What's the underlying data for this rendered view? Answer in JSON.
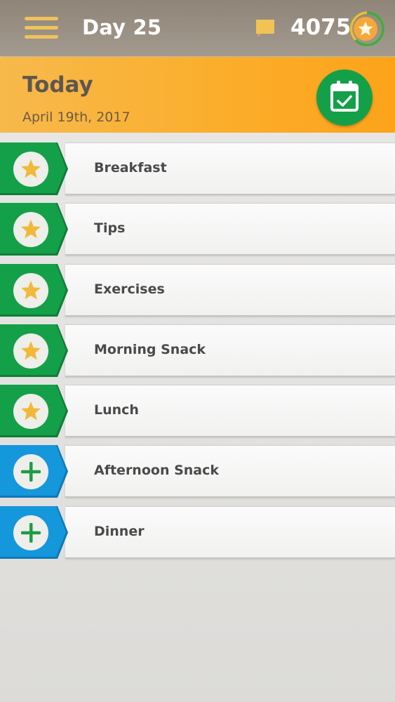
{
  "header": {
    "day_label": "Day 25",
    "points": "4075",
    "icons": {
      "menu": "hamburger-menu-icon",
      "chat": "chat-bubble-icon",
      "badge": "star-badge-icon"
    }
  },
  "today": {
    "title": "Today",
    "date": "April 19th, 2017",
    "calendar_icon": "calendar-check-icon"
  },
  "meals": [
    {
      "label": "Breakfast",
      "status": "completed",
      "icon": "star-icon"
    },
    {
      "label": "Tips",
      "status": "completed",
      "icon": "star-icon"
    },
    {
      "label": "Exercises",
      "status": "completed",
      "icon": "star-icon"
    },
    {
      "label": "Morning Snack",
      "status": "completed",
      "icon": "star-icon"
    },
    {
      "label": "Lunch",
      "status": "completed",
      "icon": "star-icon"
    },
    {
      "label": "Afternoon Snack",
      "status": "pending",
      "icon": "plus-icon"
    },
    {
      "label": "Dinner",
      "status": "pending",
      "icon": "plus-icon"
    }
  ],
  "colors": {
    "topbar": "#9a9084",
    "accent_orange": "#fbad2c",
    "completed_green": "#14a048",
    "pending_blue": "#1597dc",
    "star_gold": "#f0b93a",
    "menu_gold": "#f0c35a"
  }
}
